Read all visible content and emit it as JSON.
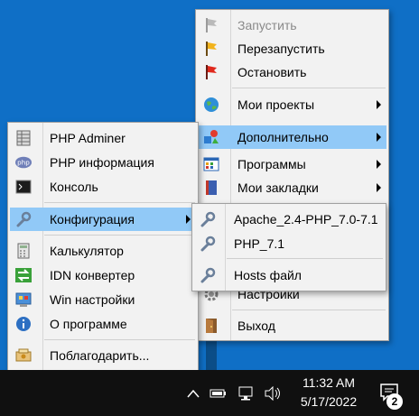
{
  "colors": {
    "desktop": "#0f6fc6",
    "menu_bg": "#f2f2f2",
    "highlight": "#91c9f7",
    "taskbar": "#101010",
    "disabled_text": "#8a8a8a"
  },
  "main_menu": {
    "items": [
      {
        "label": "Запустить",
        "icon": "green-flag-icon",
        "disabled": true
      },
      {
        "label": "Перезапустить",
        "icon": "yellow-flag-icon"
      },
      {
        "label": "Остановить",
        "icon": "red-flag-icon"
      },
      {
        "label": "Мои проекты",
        "icon": "globe-icon",
        "submenu": true
      },
      {
        "label": "Дополнительно",
        "icon": "shapes-icon",
        "submenu": true,
        "highlighted": true
      },
      {
        "label": "Программы",
        "icon": "window-grid-icon",
        "submenu": true
      },
      {
        "label": "Мои закладки",
        "icon": "book-icon",
        "submenu": true
      },
      {
        "label": "Настройки",
        "icon": "gear-icon"
      },
      {
        "label": "Выход",
        "icon": "door-exit-icon"
      }
    ]
  },
  "extra_menu": {
    "items": [
      {
        "label": "PHP Adminer",
        "icon": "database-grid-icon"
      },
      {
        "label": "PHP информация",
        "icon": "php-icon"
      },
      {
        "label": "Консоль",
        "icon": "console-icon"
      },
      {
        "label": "Конфигурация",
        "icon": "wrench-icon",
        "submenu": true,
        "highlighted": true
      },
      {
        "label": "Калькулятор",
        "icon": "calculator-icon"
      },
      {
        "label": "IDN конвертер",
        "icon": "convert-arrows-icon"
      },
      {
        "label": "Win настройки",
        "icon": "control-panel-icon"
      },
      {
        "label": "О программе",
        "icon": "info-icon"
      },
      {
        "label": "Поблагодарить...",
        "icon": "donate-icon"
      }
    ]
  },
  "config_menu": {
    "items": [
      {
        "label": "Apache_2.4-PHP_7.0-7.1",
        "icon": "wrench-icon"
      },
      {
        "label": "PHP_7.1",
        "icon": "wrench-icon"
      },
      {
        "label": "Hosts файл",
        "icon": "wrench-icon"
      }
    ]
  },
  "taskbar": {
    "time": "11:32 AM",
    "date": "5/17/2022",
    "notification_count": "2",
    "tray_icons": [
      "chevron-up-icon",
      "battery-icon",
      "network-icon",
      "volume-icon"
    ]
  }
}
